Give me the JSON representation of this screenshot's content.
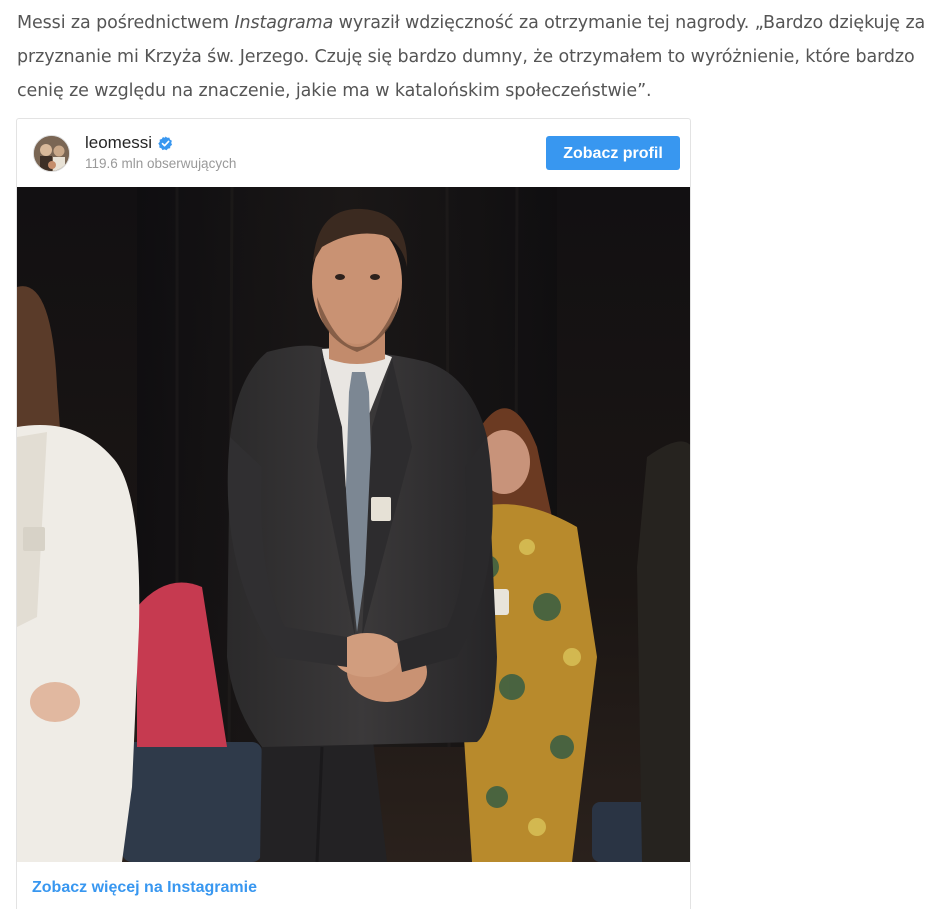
{
  "article": {
    "paragraph_before": "Messi za pośrednictwem ",
    "paragraph_emphasis": "Instagrama",
    "paragraph_after": " wyraził wdzięczność za otrzymanie tej nagrody. „Bardzo dziękuję za przyznanie mi Krzyża św. Jerzego. Czuję się bardzo dumny, że otrzymałem to wyróżnienie, które bardzo cenię ze względu na znaczenie, jakie ma w katalońskim społeczeństwie”."
  },
  "instagram_embed": {
    "username": "leomessi",
    "followers": "119.6 mln obserwujących",
    "profile_button": "Zobacz profil",
    "footer_link": "Zobacz więcej na Instagramie",
    "verified_icon": "verified-badge-icon",
    "accent_color": "#3897f0"
  }
}
